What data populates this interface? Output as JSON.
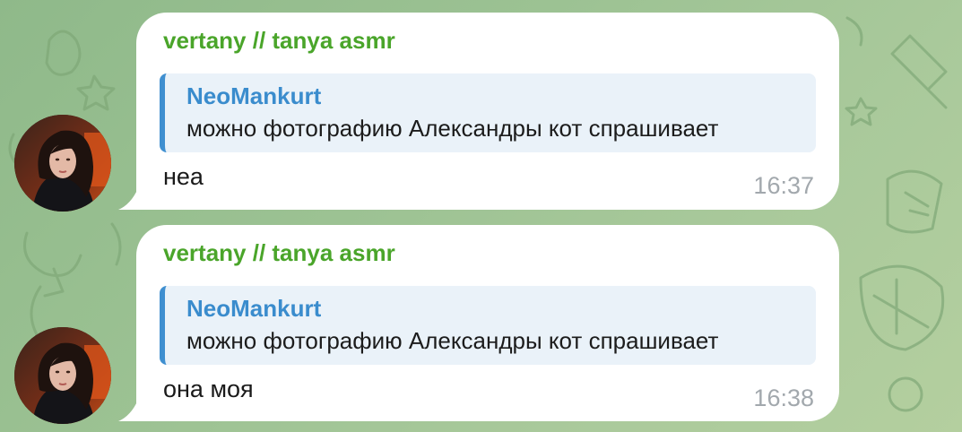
{
  "messages": [
    {
      "sender": "vertany // tanya asmr",
      "reply": {
        "name": "NeoMankurt",
        "text": "можно фотографию Александры кот спрашивает"
      },
      "text": "неа",
      "time": "16:37"
    },
    {
      "sender": "vertany // tanya asmr",
      "reply": {
        "name": "NeoMankurt",
        "text": "можно фотографию Александры кот спрашивает"
      },
      "text": "она моя",
      "time": "16:38"
    }
  ],
  "colors": {
    "background": "#9cc293",
    "sender": "#4aa52a",
    "reply_name": "#3a8ccd",
    "reply_bar": "#3f8fd0",
    "reply_bg": "#eaf2f9",
    "time": "#a2a8ad"
  }
}
